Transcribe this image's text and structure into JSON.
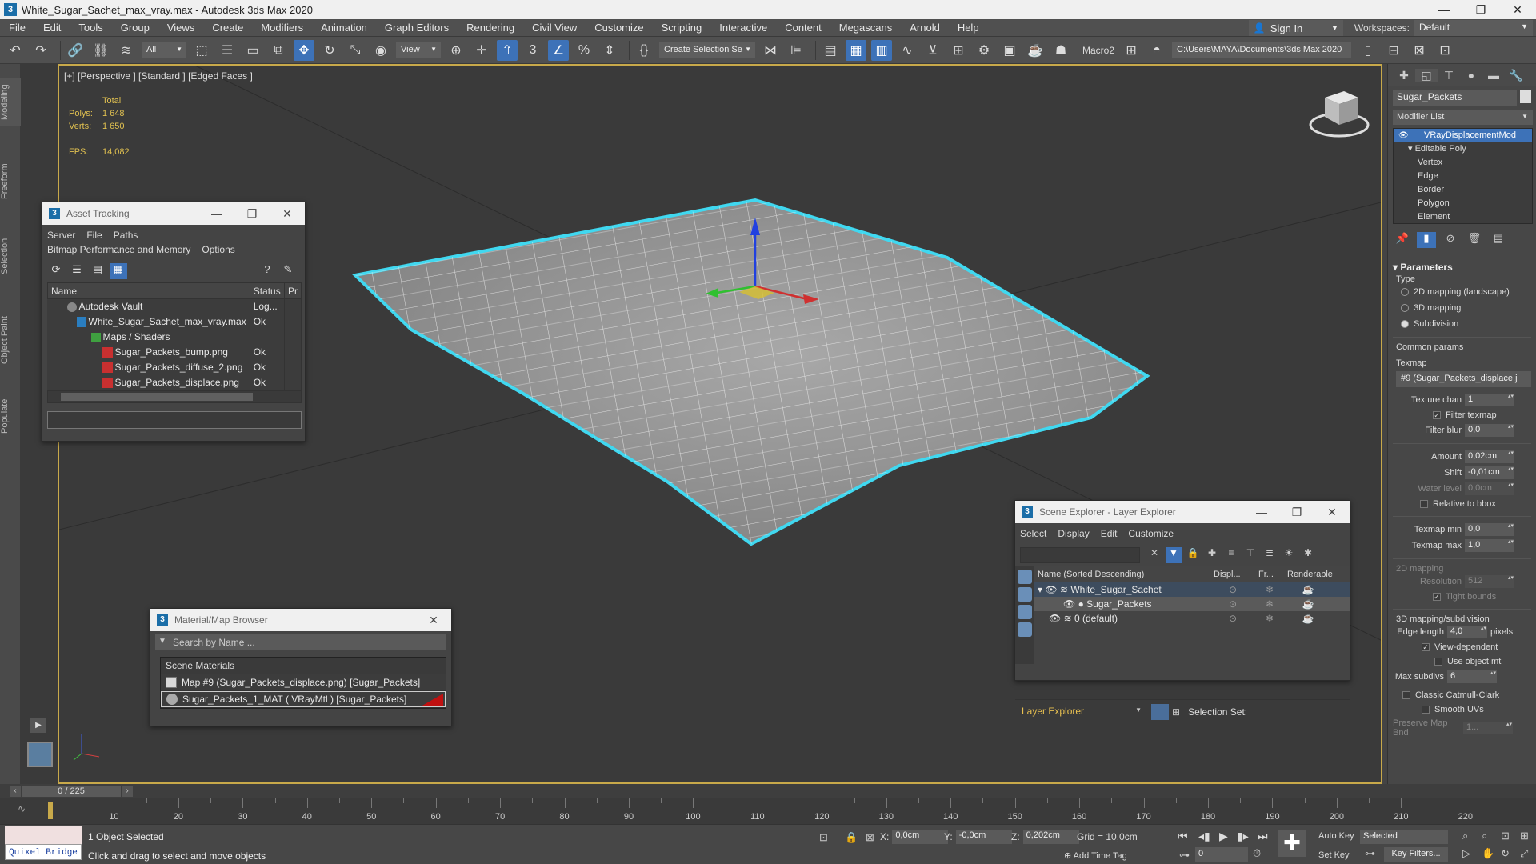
{
  "window": {
    "title": "White_Sugar_Sachet_max_vray.max - Autodesk 3ds Max 2020",
    "app_icon": "3",
    "minimize": "—",
    "maximize": "❐",
    "close": "✕"
  },
  "menu": [
    "File",
    "Edit",
    "Tools",
    "Group",
    "Views",
    "Create",
    "Modifiers",
    "Animation",
    "Graph Editors",
    "Rendering",
    "Civil View",
    "Customize",
    "Scripting",
    "Interactive",
    "Content",
    "Megascans",
    "Arnold",
    "Help"
  ],
  "account": {
    "sign_in": "Sign In",
    "workspaces_label": "Workspaces:",
    "workspace": "Default"
  },
  "toolbar": {
    "filter": "All",
    "ref_coord": "View",
    "selection_set": "Create Selection Se",
    "macro": "Macro2",
    "path": "C:\\Users\\MAYA\\Documents\\3ds Max 2020"
  },
  "left_tabs": [
    "Modeling",
    "Freeform",
    "Selection",
    "Object Paint",
    "Populate"
  ],
  "viewport": {
    "label": "[+] [Perspective ] [Standard ] [Edged Faces ]",
    "stats": {
      "total": "Total",
      "polys_label": "Polys:",
      "polys": "1 648",
      "verts_label": "Verts:",
      "verts": "1 650",
      "fps_label": "FPS:",
      "fps": "14,082"
    }
  },
  "asset_tracking": {
    "title": "Asset Tracking",
    "menu": [
      "Server",
      "File",
      "Paths",
      "Bitmap Performance and Memory",
      "Options"
    ],
    "columns": [
      "Name",
      "Status",
      "Pr"
    ],
    "rows": [
      {
        "name": "Autodesk Vault",
        "status": "Log...",
        "icon": "vault-icon"
      },
      {
        "name": "White_Sugar_Sachet_max_vray.max",
        "status": "Ok",
        "icon": "max-file-icon"
      },
      {
        "name": "Maps / Shaders",
        "status": "",
        "icon": "folder-icon"
      },
      {
        "name": "Sugar_Packets_bump.png",
        "status": "Ok",
        "icon": "image-file-icon"
      },
      {
        "name": "Sugar_Packets_diffuse_2.png",
        "status": "Ok",
        "icon": "image-file-icon"
      },
      {
        "name": "Sugar_Packets_displace.png",
        "status": "Ok",
        "icon": "image-file-icon"
      }
    ]
  },
  "material_browser": {
    "title": "Material/Map Browser",
    "search_placeholder": "Search by Name ...",
    "group": "Scene Materials",
    "items": [
      "Map #9 (Sugar_Packets_displace.png) [Sugar_Packets]",
      "Sugar_Packets_1_MAT  ( VRayMtl )  [Sugar_Packets]"
    ]
  },
  "scene_explorer": {
    "title": "Scene Explorer - Layer Explorer",
    "menu": [
      "Select",
      "Display",
      "Edit",
      "Customize"
    ],
    "columns": [
      "Name (Sorted Descending)",
      "Displ...",
      "Fr...",
      "Renderable"
    ],
    "rows": [
      "White_Sugar_Sachet",
      "Sugar_Packets",
      "0 (default)"
    ],
    "explorer": "Layer Explorer",
    "selection_set_label": "Selection Set:"
  },
  "command_panel": {
    "object_name": "Sugar_Packets",
    "modifier_list": "Modifier List",
    "stack": {
      "top": "VRayDisplacementMod",
      "editable_poly": "Editable Poly",
      "subs": [
        "Vertex",
        "Edge",
        "Border",
        "Polygon",
        "Element"
      ]
    },
    "parameters": "Parameters",
    "type_label": "Type",
    "types": [
      "2D mapping (landscape)",
      "3D mapping",
      "Subdivision"
    ],
    "selected_type": 2,
    "common_params": "Common params",
    "texmap_label": "Texmap",
    "texmap": "#9 (Sugar_Packets_displace.j",
    "texture_chan_label": "Texture chan",
    "texture_chan": "1",
    "filter_texmap": "Filter texmap",
    "filter_blur_label": "Filter blur",
    "filter_blur": "0,0",
    "amount_label": "Amount",
    "amount": "0,02cm",
    "shift_label": "Shift",
    "shift": "-0,01cm",
    "water_level_label": "Water level",
    "water_level": "0,0cm",
    "relative_bbox": "Relative to bbox",
    "texmap_min_label": "Texmap min",
    "texmap_min": "0,0",
    "texmap_max_label": "Texmap max",
    "texmap_max": "1,0",
    "mapping2d": "2D mapping",
    "resolution_label": "Resolution",
    "resolution": "512",
    "tight_bounds": "Tight bounds",
    "mapping3d": "3D mapping/subdivision",
    "edge_length_label": "Edge length",
    "edge_length": "4,0",
    "pixels": "pixels",
    "view_dependent": "View-dependent",
    "use_object_mtl": "Use object mtl",
    "max_subdivs_label": "Max subdivs",
    "max_subdivs": "6",
    "classic_cc": "Classic Catmull-Clark",
    "smooth_uvs": "Smooth UVs",
    "preserve_map": "Preserve Map Bnd",
    "preserve_val": "1..."
  },
  "timeline": {
    "frame": "0 / 225",
    "ticks": [
      10,
      20,
      30,
      40,
      50,
      60,
      70,
      80,
      90,
      100,
      110,
      120,
      130,
      140,
      150,
      160,
      170,
      180,
      190,
      200,
      210,
      220
    ],
    "max": 225
  },
  "status": {
    "quixel": "Quixel Bridge",
    "selected": "1 Object Selected",
    "hint": "Click and drag to select and move objects",
    "x_label": "X:",
    "x": "0,0cm",
    "y_label": "Y:",
    "y": "-0,0cm",
    "z_label": "Z:",
    "z": "0,202cm",
    "grid": "Grid = 10,0cm",
    "add_time_tag": "Add Time Tag",
    "auto_key": "Auto Key",
    "selected_dd": "Selected",
    "set_key": "Set Key",
    "key_filters": "Key Filters...",
    "frame_field": "0"
  }
}
